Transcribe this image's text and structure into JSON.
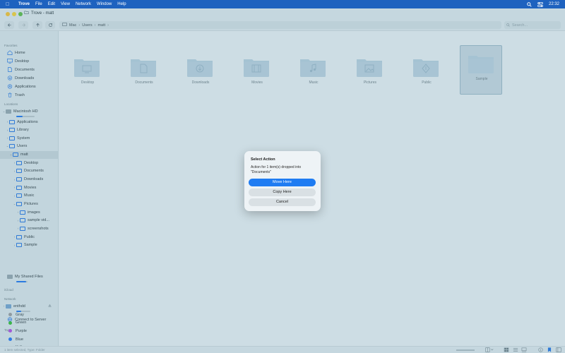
{
  "menubar": {
    "app_name": "Trove",
    "menus": [
      "File",
      "Edit",
      "View",
      "Network",
      "Window",
      "Help"
    ],
    "clock": "22:32"
  },
  "window": {
    "title": "Trove - matt"
  },
  "toolbar": {
    "breadcrumb": [
      "Mac",
      "Users",
      "matt"
    ],
    "search_placeholder": "Search..."
  },
  "sidebar": {
    "favorites_header": "Favorites",
    "favorites": [
      "Home",
      "Desktop",
      "Documents",
      "Downloads",
      "Applications",
      "Trash"
    ],
    "locations_header": "Locations",
    "drive": "Macintosh HD",
    "drive_usage": 0.35,
    "tree": [
      {
        "label": "Applications",
        "depth": 1
      },
      {
        "label": "Library",
        "depth": 1
      },
      {
        "label": "System",
        "depth": 1
      },
      {
        "label": "Users",
        "depth": 1
      },
      {
        "label": "matt",
        "depth": 2
      },
      {
        "label": "Desktop",
        "depth": 3
      },
      {
        "label": "Documents",
        "depth": 3
      },
      {
        "label": "Downloads",
        "depth": 3
      },
      {
        "label": "Movies",
        "depth": 3
      },
      {
        "label": "Music",
        "depth": 3
      },
      {
        "label": "Pictures",
        "depth": 3
      },
      {
        "label": "images",
        "depth": 4
      },
      {
        "label": "sample vid...",
        "depth": 4
      },
      {
        "label": "screenshots",
        "depth": 4
      },
      {
        "label": "Public",
        "depth": 3
      },
      {
        "label": "Sample",
        "depth": 3
      }
    ],
    "shared": "My Shared Files",
    "shared_usage": 0.55,
    "icloud_header": "iCloud",
    "network_header": "Network",
    "network_item": "enthdd",
    "network_usage": 0.35,
    "connect": "Connect to Server",
    "tags_header": "Tags",
    "tags": [
      {
        "label": "Gray",
        "color": "#8e9aa1"
      },
      {
        "label": "Green",
        "color": "#3bb54a"
      },
      {
        "label": "Purple",
        "color": "#a05ad6"
      },
      {
        "label": "Blue",
        "color": "#2f7ae5"
      },
      {
        "label": "Yellow",
        "color": "#e5c530"
      }
    ]
  },
  "content": {
    "folders": [
      {
        "name": "Desktop",
        "icon": "desktop-glyph"
      },
      {
        "name": "Documents",
        "icon": "document-glyph"
      },
      {
        "name": "Downloads",
        "icon": "download-glyph"
      },
      {
        "name": "Movies",
        "icon": "film-glyph"
      },
      {
        "name": "Music",
        "icon": "music-glyph"
      },
      {
        "name": "Pictures",
        "icon": "picture-glyph"
      },
      {
        "name": "Public",
        "icon": "public-glyph"
      },
      {
        "name": "Sample",
        "icon": "none"
      }
    ],
    "selected": "Sample"
  },
  "statusbar": {
    "text": "1 item selected, Type: Folder"
  },
  "dialog": {
    "title": "Select Action",
    "message": "Action for 1 item(s) dropped into \"Documents\"",
    "move_label": "Move Here",
    "copy_label": "Copy Here",
    "cancel_label": "Cancel"
  },
  "colors": {
    "accent": "#1f7cf2",
    "folder": "#a8c4d4"
  }
}
